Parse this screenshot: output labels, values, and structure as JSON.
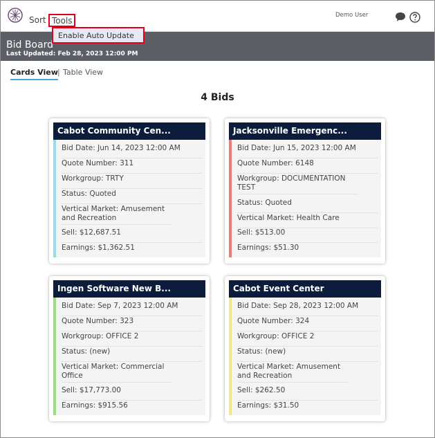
{
  "app": {
    "menu": {
      "sort": "Sort",
      "tools": "Tools"
    },
    "user": "Demo User",
    "tools_dropdown": {
      "item": "Enable Auto Update"
    }
  },
  "banner": {
    "title": "Bid Board",
    "subtitle": "Last Updated: Feb 28, 2023 12:00 PM"
  },
  "views": {
    "cards": "Cards View",
    "separator": "|",
    "table": "Table View"
  },
  "count_label": "4 Bids",
  "colors": {
    "accent_blue": "#9bd7ee",
    "accent_red": "#f07a7a",
    "accent_green": "#9be07a",
    "accent_yellow": "#eeea8c",
    "header_navy": "#0b1c3d",
    "highlight_red": "#e0001b"
  },
  "cards": [
    {
      "title": "Cabot Community Cen...",
      "bid_date": "Bid Date: Jun 14, 2023 12:00 AM",
      "quote": "Quote Number: 311",
      "workgroup": "Workgroup: TRTY",
      "status": "Status: Quoted",
      "vertical": "Vertical Market: Amusement and Recreation",
      "sell": "Sell: $12,687.51",
      "earnings": "Earnings: $1,362.51"
    },
    {
      "title": "Jacksonville Emergenc...",
      "bid_date": "Bid Date: Jun 15, 2023 12:00 AM",
      "quote": "Quote Number: 6148",
      "workgroup": "Workgroup: DOCUMENTATION TEST",
      "status": "Status: Quoted",
      "vertical": "Vertical Market: Health Care",
      "sell": "Sell: $513.00",
      "earnings": "Earnings: $51.30"
    },
    {
      "title": "Ingen Software New B...",
      "bid_date": "Bid Date: Sep 7, 2023 12:00 AM",
      "quote": "Quote Number: 323",
      "workgroup": "Workgroup: OFFICE 2",
      "status": "Status: (new)",
      "vertical": "Vertical Market: Commercial Office",
      "sell": "Sell: $17,773.00",
      "earnings": "Earnings: $915.56"
    },
    {
      "title": "Cabot Event Center",
      "bid_date": "Bid Date: Sep 28, 2023 12:00 AM",
      "quote": "Quote Number: 324",
      "workgroup": "Workgroup: OFFICE 2",
      "status": "Status: (new)",
      "vertical": "Vertical Market: Amusement and Recreation",
      "sell": "Sell: $262.50",
      "earnings": "Earnings: $31.50"
    }
  ]
}
